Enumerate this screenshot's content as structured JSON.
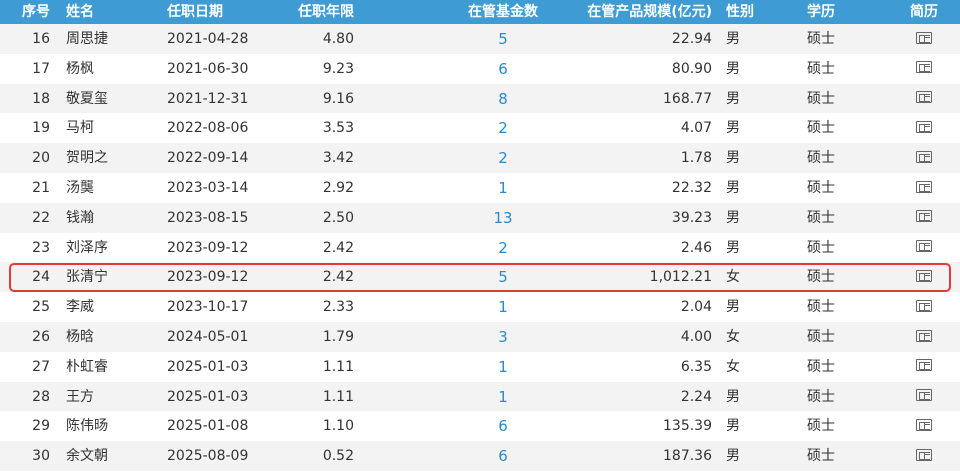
{
  "header": {
    "idx": "序号",
    "name": "姓名",
    "start_date": "任职日期",
    "tenure": "任职年限",
    "funds_managed": "在管基金数",
    "scale": "在管产品规模(亿元)",
    "gender": "性别",
    "education": "学历",
    "cv": "简历"
  },
  "rows": [
    {
      "idx": "16",
      "name": "周思捷",
      "start_date": "2021-04-28",
      "tenure": "4.80",
      "funds": "5",
      "scale": "22.94",
      "gender": "男",
      "education": "硕士"
    },
    {
      "idx": "17",
      "name": "杨枫",
      "start_date": "2021-06-30",
      "tenure": "9.23",
      "funds": "6",
      "scale": "80.90",
      "gender": "男",
      "education": "硕士"
    },
    {
      "idx": "18",
      "name": "敬夏玺",
      "start_date": "2021-12-31",
      "tenure": "9.16",
      "funds": "8",
      "scale": "168.77",
      "gender": "男",
      "education": "硕士"
    },
    {
      "idx": "19",
      "name": "马柯",
      "start_date": "2022-08-06",
      "tenure": "3.53",
      "funds": "2",
      "scale": "4.07",
      "gender": "男",
      "education": "硕士"
    },
    {
      "idx": "20",
      "name": "贺明之",
      "start_date": "2022-09-14",
      "tenure": "3.42",
      "funds": "2",
      "scale": "1.78",
      "gender": "男",
      "education": "硕士"
    },
    {
      "idx": "21",
      "name": "汤龑",
      "start_date": "2023-03-14",
      "tenure": "2.92",
      "funds": "1",
      "scale": "22.32",
      "gender": "男",
      "education": "硕士"
    },
    {
      "idx": "22",
      "name": "钱瀚",
      "start_date": "2023-08-15",
      "tenure": "2.50",
      "funds": "13",
      "scale": "39.23",
      "gender": "男",
      "education": "硕士"
    },
    {
      "idx": "23",
      "name": "刘泽序",
      "start_date": "2023-09-12",
      "tenure": "2.42",
      "funds": "2",
      "scale": "2.46",
      "gender": "男",
      "education": "硕士"
    },
    {
      "idx": "24",
      "name": "张清宁",
      "start_date": "2023-09-12",
      "tenure": "2.42",
      "funds": "5",
      "scale": "1,012.21",
      "gender": "女",
      "education": "硕士"
    },
    {
      "idx": "25",
      "name": "李威",
      "start_date": "2023-10-17",
      "tenure": "2.33",
      "funds": "1",
      "scale": "2.04",
      "gender": "男",
      "education": "硕士"
    },
    {
      "idx": "26",
      "name": "杨晗",
      "start_date": "2024-05-01",
      "tenure": "1.79",
      "funds": "3",
      "scale": "4.00",
      "gender": "女",
      "education": "硕士"
    },
    {
      "idx": "27",
      "name": "朴虹睿",
      "start_date": "2025-01-03",
      "tenure": "1.11",
      "funds": "1",
      "scale": "6.35",
      "gender": "女",
      "education": "硕士"
    },
    {
      "idx": "28",
      "name": "王方",
      "start_date": "2025-01-03",
      "tenure": "1.11",
      "funds": "1",
      "scale": "2.24",
      "gender": "男",
      "education": "硕士"
    },
    {
      "idx": "29",
      "name": "陈伟旸",
      "start_date": "2025-01-08",
      "tenure": "1.10",
      "funds": "6",
      "scale": "135.39",
      "gender": "男",
      "education": "硕士"
    },
    {
      "idx": "30",
      "name": "余文朝",
      "start_date": "2025-08-09",
      "tenure": "0.52",
      "funds": "6",
      "scale": "187.36",
      "gender": "男",
      "education": "硕士"
    }
  ],
  "highlighted_row_idx": "24",
  "colors": {
    "header_bg": "#3f9bd4",
    "link": "#2a8ad0",
    "highlight_border": "#e53935",
    "stripe": "#f3f3f3"
  },
  "icons": {
    "cv": "resume-card-icon"
  }
}
